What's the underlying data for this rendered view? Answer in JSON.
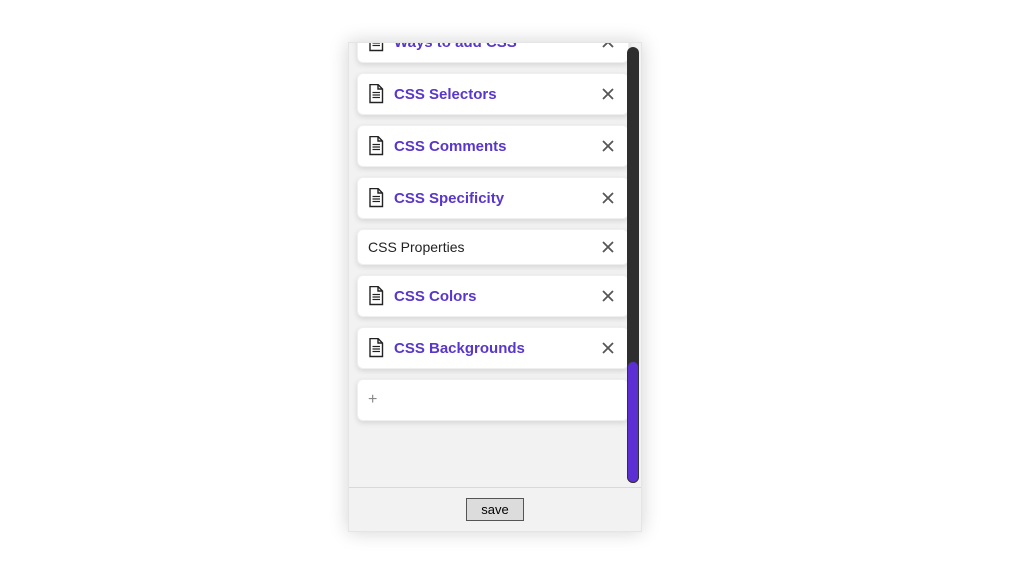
{
  "colors": {
    "accent": "#5936cc",
    "scrollbar_thumb": "#5c2fd4"
  },
  "items": [
    {
      "type": "link",
      "label": "Ways to add CSS"
    },
    {
      "type": "link",
      "label": "CSS Selectors"
    },
    {
      "type": "link",
      "label": "CSS Comments"
    },
    {
      "type": "link",
      "label": "CSS Specificity"
    },
    {
      "type": "section",
      "label": "CSS Properties"
    },
    {
      "type": "link",
      "label": "CSS Colors"
    },
    {
      "type": "link",
      "label": "CSS Backgrounds"
    }
  ],
  "add_label": "+",
  "footer": {
    "save_label": "save"
  }
}
